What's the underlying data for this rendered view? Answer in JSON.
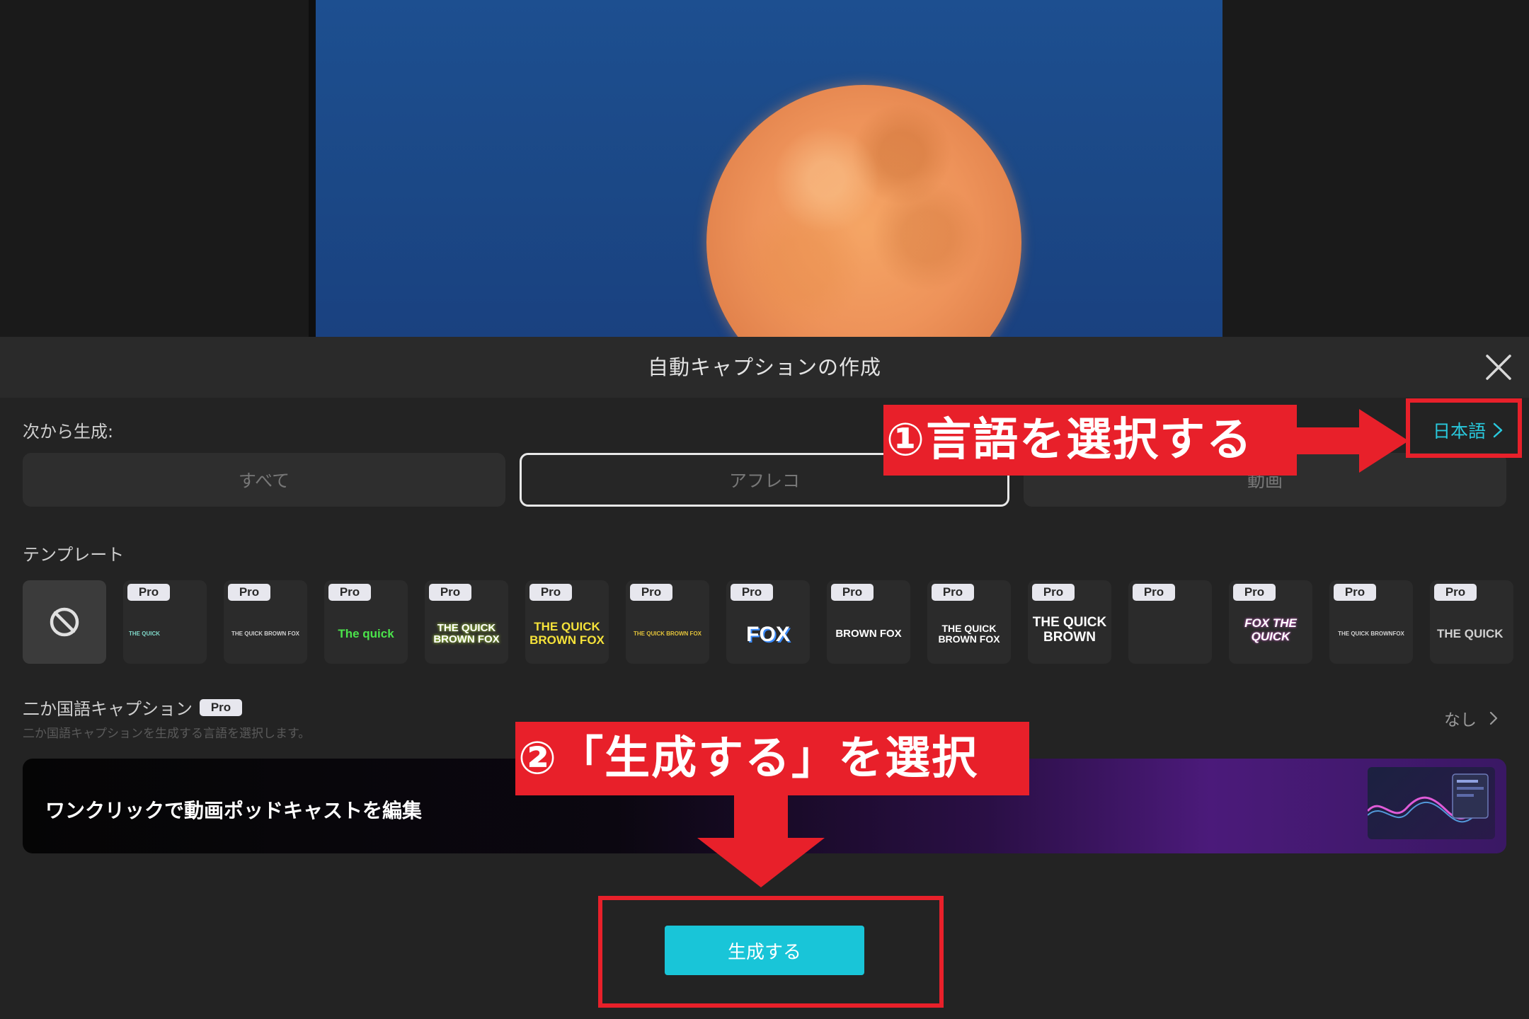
{
  "dialog": {
    "title": "自動キャプションの作成",
    "source_label": "次から生成:",
    "language": "日本語",
    "source_options": [
      {
        "label": "すべて",
        "selected": false
      },
      {
        "label": "アフレコ",
        "selected": true
      },
      {
        "label": "動画",
        "selected": false
      }
    ],
    "template_label": "テンプレート",
    "templates": [
      {
        "pro": "",
        "text": ""
      },
      {
        "pro": "Pro",
        "text": "THE QUICK"
      },
      {
        "pro": "Pro",
        "text": "THE QUICK BROWN FOX"
      },
      {
        "pro": "Pro",
        "text": "The quick"
      },
      {
        "pro": "Pro",
        "text": "THE QUICK BROWN FOX"
      },
      {
        "pro": "Pro",
        "text": "THE QUICK BROWN FOX"
      },
      {
        "pro": "Pro",
        "text": "THE QUICK BROWN FOX"
      },
      {
        "pro": "Pro",
        "text": "FOX"
      },
      {
        "pro": "Pro",
        "text": "BROWN FOX"
      },
      {
        "pro": "Pro",
        "text": "THE QUICK BROWN FOX"
      },
      {
        "pro": "Pro",
        "text": "THE QUICK BROWN"
      },
      {
        "pro": "Pro",
        "text": ""
      },
      {
        "pro": "Pro",
        "text": "FOX THE QUICK"
      },
      {
        "pro": "Pro",
        "text": "THE QUICK BROWNFOX"
      },
      {
        "pro": "Pro",
        "text": "THE QUICK"
      }
    ],
    "bilingual": {
      "title": "二か国語キャプション",
      "badge": "Pro",
      "description": "二か国語キャプションを生成する言語を選択します。",
      "value": "なし"
    },
    "banner_text": "ワンクリックで動画ポッドキャストを編集",
    "generate_label": "生成する"
  },
  "annotations": {
    "step1": "①言語を選択する",
    "step2": "②「生成する」を選択",
    "color": "#e8202a"
  },
  "colors": {
    "accent": "#19c5d8",
    "language_link": "#29c9dd",
    "background": "#232323"
  }
}
